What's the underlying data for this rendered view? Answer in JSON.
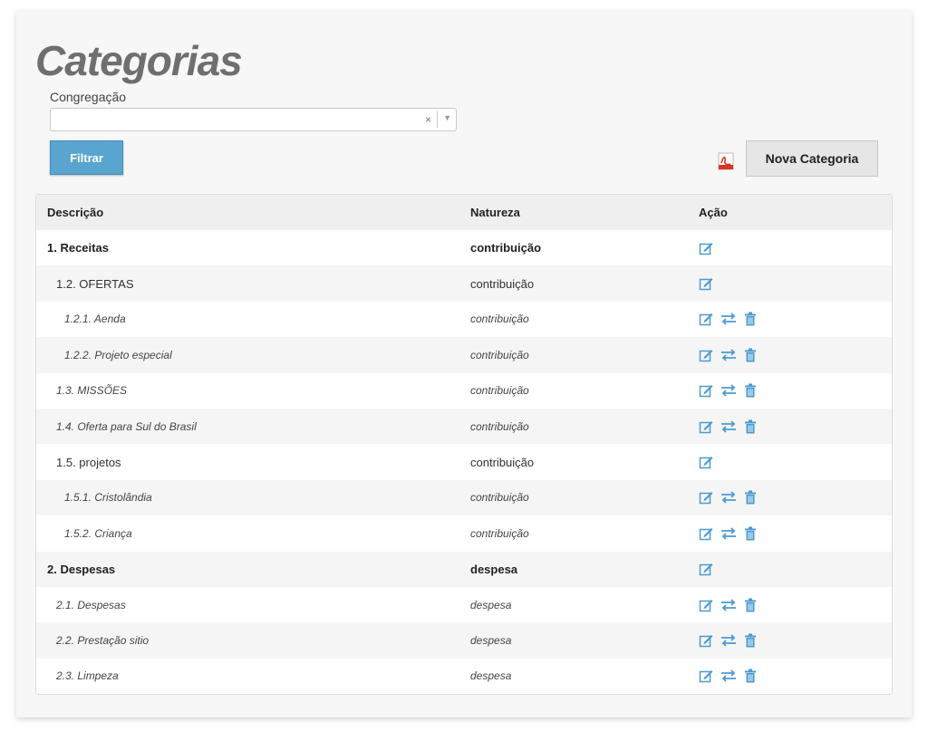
{
  "page": {
    "title": "Categorias"
  },
  "filter": {
    "label": "Congregação",
    "value": "",
    "clear_glyph": "×",
    "arrow_glyph": "▼",
    "button_label": "Filtrar"
  },
  "actions": {
    "new_label": "Nova Categoria",
    "pdf_icon": "pdf-icon"
  },
  "table": {
    "headers": [
      "Descrição",
      "Natureza",
      "Ação"
    ],
    "rows": [
      {
        "descricao": "1. Receitas",
        "natureza": "contribuição",
        "level": 1,
        "actions": [
          "edit"
        ]
      },
      {
        "descricao": "1.2. OFERTAS",
        "natureza": "contribuição",
        "level": 2,
        "actions": [
          "edit"
        ]
      },
      {
        "descricao": "1.2.1. Aenda",
        "natureza": "contribuição",
        "level": 3,
        "actions": [
          "edit",
          "move",
          "delete"
        ]
      },
      {
        "descricao": "1.2.2. Projeto especial",
        "natureza": "contribuição",
        "level": 3,
        "actions": [
          "edit",
          "move",
          "delete"
        ]
      },
      {
        "descricao": "1.3. MISSÕES",
        "natureza": "contribuição",
        "level": 2,
        "italic": true,
        "actions": [
          "edit",
          "move",
          "delete"
        ]
      },
      {
        "descricao": "1.4. Oferta para Sul do Brasil",
        "natureza": "contribuição",
        "level": 2,
        "italic": true,
        "actions": [
          "edit",
          "move",
          "delete"
        ]
      },
      {
        "descricao": "1.5. projetos",
        "natureza": "contribuição",
        "level": 2,
        "actions": [
          "edit"
        ]
      },
      {
        "descricao": "1.5.1. Cristolândia",
        "natureza": "contribuição",
        "level": 3,
        "actions": [
          "edit",
          "move",
          "delete"
        ]
      },
      {
        "descricao": "1.5.2. Criança",
        "natureza": "contribuição",
        "level": 3,
        "actions": [
          "edit",
          "move",
          "delete"
        ]
      },
      {
        "descricao": "2. Despesas",
        "natureza": "despesa",
        "level": 1,
        "actions": [
          "edit"
        ]
      },
      {
        "descricao": "2.1. Despesas",
        "natureza": "despesa",
        "level": 2,
        "italic": true,
        "actions": [
          "edit",
          "move",
          "delete"
        ]
      },
      {
        "descricao": "2.2. Prestação sitio",
        "natureza": "despesa",
        "level": 2,
        "italic": true,
        "actions": [
          "edit",
          "move",
          "delete"
        ]
      },
      {
        "descricao": "2.3. Limpeza",
        "natureza": "despesa",
        "level": 2,
        "italic": true,
        "actions": [
          "edit",
          "move",
          "delete"
        ]
      }
    ]
  },
  "colors": {
    "accent": "#5aa5cf",
    "icon": "#4b9bd1",
    "title": "#6f6f6f"
  }
}
